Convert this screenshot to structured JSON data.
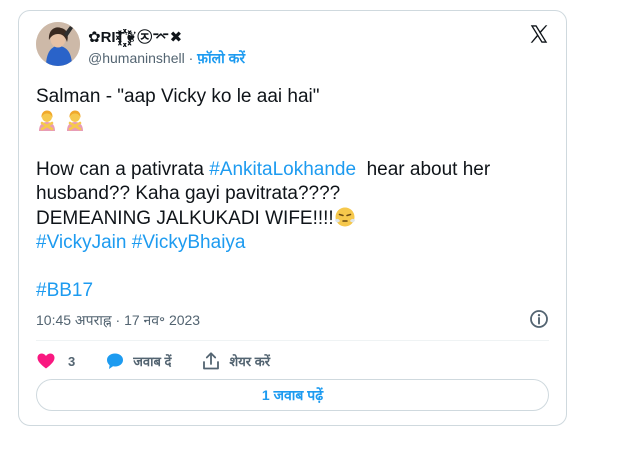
{
  "author": {
    "display_name": "✿RIT꙰꙰꙰꙰꙰❦㉨⌤✖",
    "handle": "@humaninshell",
    "separator": " · ",
    "follow_label": "फ़ॉलो करें"
  },
  "tweet": {
    "line1": "Salman - \"aap Vicky ko le aai hai\"",
    "line3_prefix": "How can a pativrata ",
    "hashtag_ankita": "#AnkitaLokhande",
    "line3_suffix": "  hear about her",
    "line4": "husband?? Kaha gayi pavitrata????",
    "line5": "DEMEANING JALKUKADI WIFE!!!!",
    "hashtag_vickyjain": "#VickyJain",
    "hashtag_vickybhaiya": "#VickyBhaiya",
    "hashtag_bb17": "#BB17",
    "emojis": [
      "person-gesturing-no-icon",
      "person-gesturing-no-icon",
      "face-with-steam-icon"
    ]
  },
  "timestamp": "10:45 अपराह्न · 17 नव॰ 2023",
  "actions": {
    "like_count": "3",
    "reply_label": "जवाब दें",
    "share_label": "शेयर करें"
  },
  "replies_button_label": "1 जवाब पढ़ें",
  "colors": {
    "link": "#1d9bf0",
    "heart": "#f91880",
    "muted": "#536471",
    "border": "#cfd9de"
  }
}
